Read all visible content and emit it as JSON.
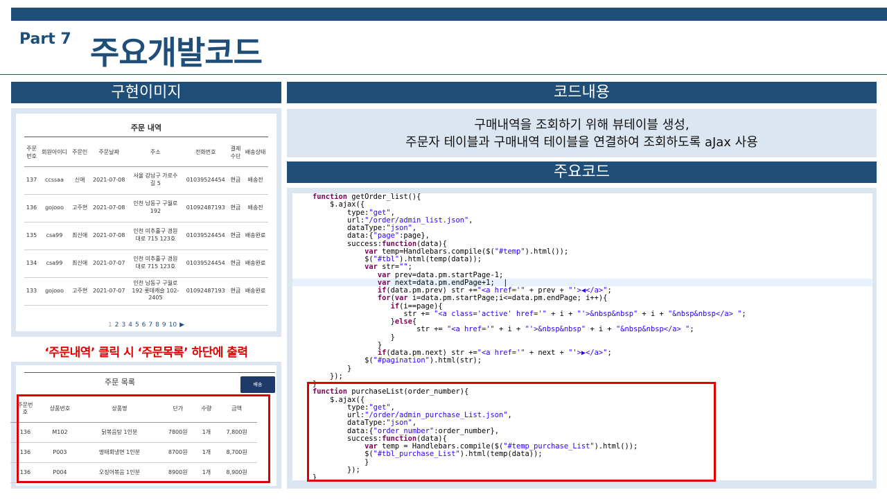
{
  "header": {
    "part": "Part 7",
    "title": "주요개발코드"
  },
  "left": {
    "section_title": "구현이미지",
    "order_table": {
      "title": "주문 내역",
      "headers": [
        "주문\n번호",
        "회원아이디",
        "주문인",
        "주문날짜",
        "주소",
        "전화번호",
        "결제\n수단",
        "배송상태"
      ],
      "rows": [
        [
          "137",
          "ccssaa",
          "신애",
          "2021-07-08",
          "서울 강남구 가로수\n길 5",
          "01039524454",
          "현금",
          "배송전"
        ],
        [
          "136",
          "gojooo",
          "고주현",
          "2021-07-08",
          "인천 남동구 구월로\n192",
          "01092487193",
          "현금",
          "배송전"
        ],
        [
          "135",
          "csa99",
          "최신애",
          "2021-07-08",
          "인천 미추홀구 경원\n대로 715 123호",
          "01039524454",
          "현금",
          "배송완료"
        ],
        [
          "134",
          "csa99",
          "최신애",
          "2021-07-07",
          "인천 미추홀구 경원\n대로 715 123호",
          "01039524454",
          "현금",
          "배송완료"
        ],
        [
          "133",
          "gojooo",
          "고주현",
          "2021-07-07",
          "인천 남동구 구월로\n192 롯데캐슬 102-\n2405",
          "01092487193",
          "현금",
          "배송완료"
        ]
      ],
      "pager": [
        "1",
        "2",
        "3",
        "4",
        "5",
        "6",
        "7",
        "8",
        "9",
        "10",
        "▶"
      ]
    },
    "caption": "‘주문내역’ 클릭 시 ‘주문목록’ 하단에 출력",
    "purchase_list": {
      "title": "주문 목록",
      "button": "배송",
      "headers": [
        "주문번\n호",
        "상품번호",
        "상품명",
        "단가",
        "수량",
        "금액"
      ],
      "rows": [
        [
          "136",
          "M102",
          "닭볶음탕 1인분",
          "7800원",
          "1개",
          "7,800원"
        ],
        [
          "136",
          "P003",
          "명태회냉면 1인분",
          "8700원",
          "1개",
          "8,700원"
        ],
        [
          "136",
          "P004",
          "오징어볶음 1인분",
          "8900원",
          "1개",
          "8,900원"
        ]
      ]
    }
  },
  "right": {
    "section_title": "코드내용",
    "description": [
      "구매내역을 조회하기 위해 뷰테이블 생성,",
      "주문자 테이블과 구매내역 테이블을 연결하여 조회하도록 aJax 사용"
    ],
    "code_title": "주요코드"
  },
  "colors": {
    "navy": "#1f4e79",
    "panel": "#dce6f1",
    "highlight": "#e00000",
    "keyword": "#7f0055",
    "string": "#2a00ff"
  }
}
